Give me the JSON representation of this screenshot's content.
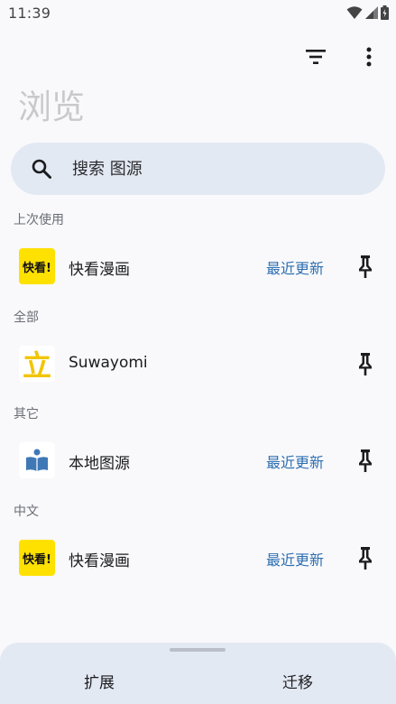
{
  "status_bar": {
    "time": "11:39"
  },
  "toolbar": {
    "filter_icon": "filter-list-icon",
    "more_icon": "more-vert-icon"
  },
  "page_title": "浏览",
  "search": {
    "placeholder": "搜索 图源",
    "icon": "search-icon"
  },
  "sections": {
    "last_used": {
      "header": "上次使用",
      "items": [
        {
          "name": "快看漫画",
          "latest": "最近更新",
          "logo": "kuaikan-logo"
        }
      ]
    },
    "all": {
      "header": "全部",
      "items": [
        {
          "name": "Suwayomi",
          "latest": "",
          "logo": "suwayomi-logo"
        }
      ]
    },
    "other": {
      "header": "其它",
      "items": [
        {
          "name": "本地图源",
          "latest": "最近更新",
          "logo": "local-source-logo"
        }
      ]
    },
    "chinese": {
      "header": "中文",
      "items": [
        {
          "name": "快看漫画",
          "latest": "最近更新",
          "logo": "kuaikan-logo"
        }
      ]
    }
  },
  "kuaikan_logo_text": "快看!",
  "suwayomi_logo_text": "立",
  "bottom_tabs": {
    "extensions": "扩展",
    "migrate": "迁移"
  },
  "colors": {
    "accent": "#2e6fb2",
    "search_bg": "#e3e9f3",
    "logo_yellow": "#ffe100"
  }
}
